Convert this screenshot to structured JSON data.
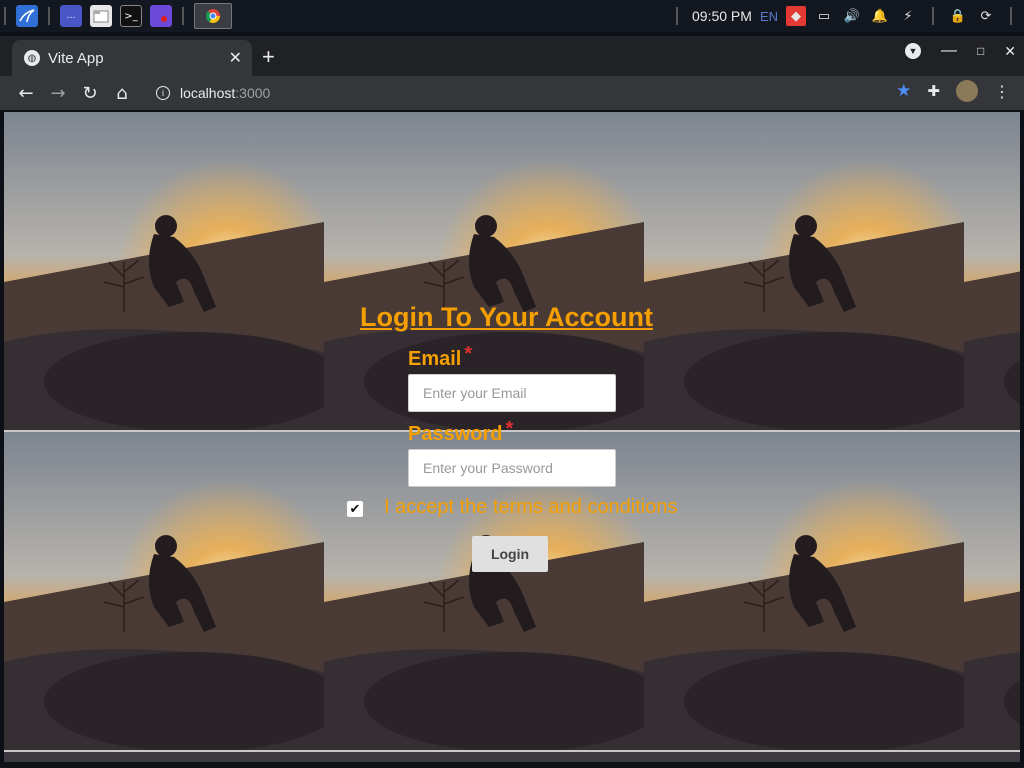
{
  "taskbar": {
    "clock": "09:50 PM",
    "language": "EN",
    "launchers": [
      "kali-menu-icon",
      "workspace-icon",
      "files-icon",
      "terminal-icon",
      "screen-recorder-icon",
      "chrome-icon"
    ]
  },
  "browser": {
    "tab_title": "Vite App",
    "url_host": "localhost",
    "url_port": ":3000"
  },
  "form": {
    "title": "Login To Your Account",
    "email_label": "Email",
    "email_placeholder": "Enter your Email",
    "password_label": "Password",
    "password_placeholder": "Enter your Password",
    "required_marker": "*",
    "terms_label": "I accept the terms and conditions",
    "terms_checked": true,
    "login_button": "Login"
  },
  "colors": {
    "accent": "#f5a000",
    "required": "#e03030"
  }
}
